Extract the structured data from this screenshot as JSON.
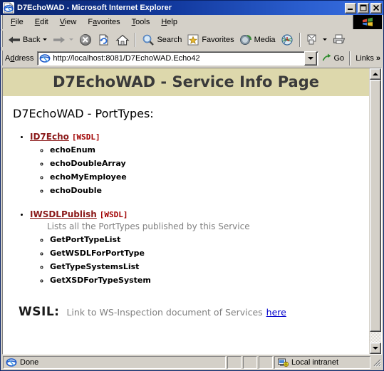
{
  "window": {
    "title": "D7EchoWAD - Microsoft Internet Explorer",
    "icon": "ie-document-icon",
    "minimize_label": "Minimize",
    "maximize_label": "Maximize",
    "close_label": "Close"
  },
  "menu": {
    "items": [
      {
        "label": "File",
        "accel": "F"
      },
      {
        "label": "Edit",
        "accel": "E"
      },
      {
        "label": "View",
        "accel": "V"
      },
      {
        "label": "Favorites",
        "accel": "a"
      },
      {
        "label": "Tools",
        "accel": "T"
      },
      {
        "label": "Help",
        "accel": "H"
      }
    ],
    "brand_icon": "windows-flag-icon"
  },
  "toolbar": {
    "back_label": "Back",
    "forward_label": "",
    "stop_label": "",
    "refresh_label": "",
    "home_label": "",
    "search_label": "Search",
    "favorites_label": "Favorites",
    "media_label": "Media",
    "history_label": "",
    "mail_label": "",
    "print_label": ""
  },
  "address": {
    "label": "Address",
    "value": "http://localhost:8081/D7EchoWAD.Echo42",
    "placeholder": "",
    "go_label": "Go",
    "links_label": "Links",
    "chevron": "»",
    "icon": "ie-page-icon"
  },
  "page": {
    "banner_title": "D7EchoWAD - Service Info Page",
    "subhead": "D7EchoWAD - PortTypes:",
    "wsdl_tag": "[WSDL]",
    "porttypes": [
      {
        "name": "ID7Echo",
        "description": "",
        "operations": [
          "echoEnum",
          "echoDoubleArray",
          "echoMyEmployee",
          "echoDouble"
        ]
      },
      {
        "name": "IWSDLPublish",
        "description": "Lists all the PortTypes published by this Service",
        "operations": [
          "GetPortTypeList",
          "GetWSDLForPortType",
          "GetTypeSystemsList",
          "GetXSDForTypeSystem"
        ]
      }
    ],
    "wsil": {
      "label": "WSIL:",
      "text": "Link to WS-Inspection document of Services",
      "link_label": "here"
    }
  },
  "statusbar": {
    "status": "Done",
    "zone": "Local intranet",
    "zone_icon": "intranet-zone-icon",
    "status_icon": "ie-page-icon"
  },
  "colors": {
    "titlebar_start": "#0a246a",
    "titlebar_end": "#3a6fe0",
    "chrome": "#d4d0c8",
    "banner": "#ddd8ac",
    "banner_text": "#3a3a3a",
    "porttype_link": "#8b1a1a",
    "wsdl_link": "#a00000",
    "muted_text": "#808080",
    "hyperlink": "#0000cc"
  }
}
